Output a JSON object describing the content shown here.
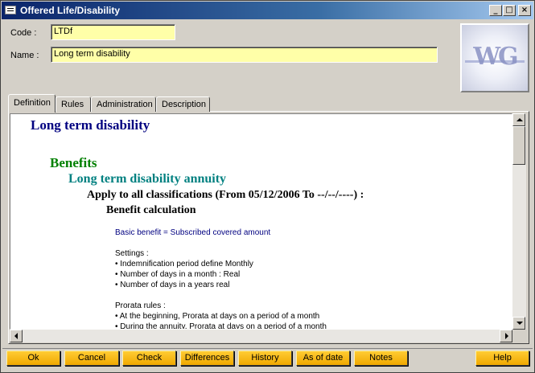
{
  "window": {
    "title": "Offered Life/Disability",
    "controls": {
      "minimize": "_",
      "maximize": "□",
      "close": "×"
    }
  },
  "form": {
    "code_label": "Code :",
    "code_value": "LTDf",
    "name_label": "Name :",
    "name_value": "Long term disability"
  },
  "logo": {
    "text": "WG",
    "icon": "company-logo"
  },
  "tabs": [
    {
      "label": "Definition",
      "active": true
    },
    {
      "label": "Rules",
      "active": false
    },
    {
      "label": "Administration",
      "active": false
    },
    {
      "label": "Description",
      "active": false
    }
  ],
  "document": {
    "title": "Long term disability",
    "section": "Benefits",
    "subsection": "Long term disability annuity",
    "applies": "Apply to all classifications (From 05/12/2006 To --/--/----) :",
    "calc_heading": "Benefit calculation",
    "formula": "Basic benefit = Subscribed covered amount",
    "settings_label": "Settings :",
    "settings": [
      "• Indemnification period define Monthly",
      "• Number of days in a month : Real",
      "• Number of days in a years real"
    ],
    "prorata_label": "Prorata rules :",
    "prorata": [
      "• At the beginning, Prorata at days on a period of a month",
      "• During the annuity, Prorata at days on a period of a month"
    ]
  },
  "buttons": {
    "ok": "Ok",
    "cancel": "Cancel",
    "check": "Check",
    "differences": "Differences",
    "history": "History",
    "as_of_date": "As of date",
    "notes": "Notes",
    "help": "Help"
  },
  "colors": {
    "title_bar": "#0a246a",
    "field_bg": "#ffffa8",
    "button_bg": "#f0a800",
    "heading_navy": "#000080",
    "heading_green": "#008000",
    "heading_teal": "#008080"
  }
}
